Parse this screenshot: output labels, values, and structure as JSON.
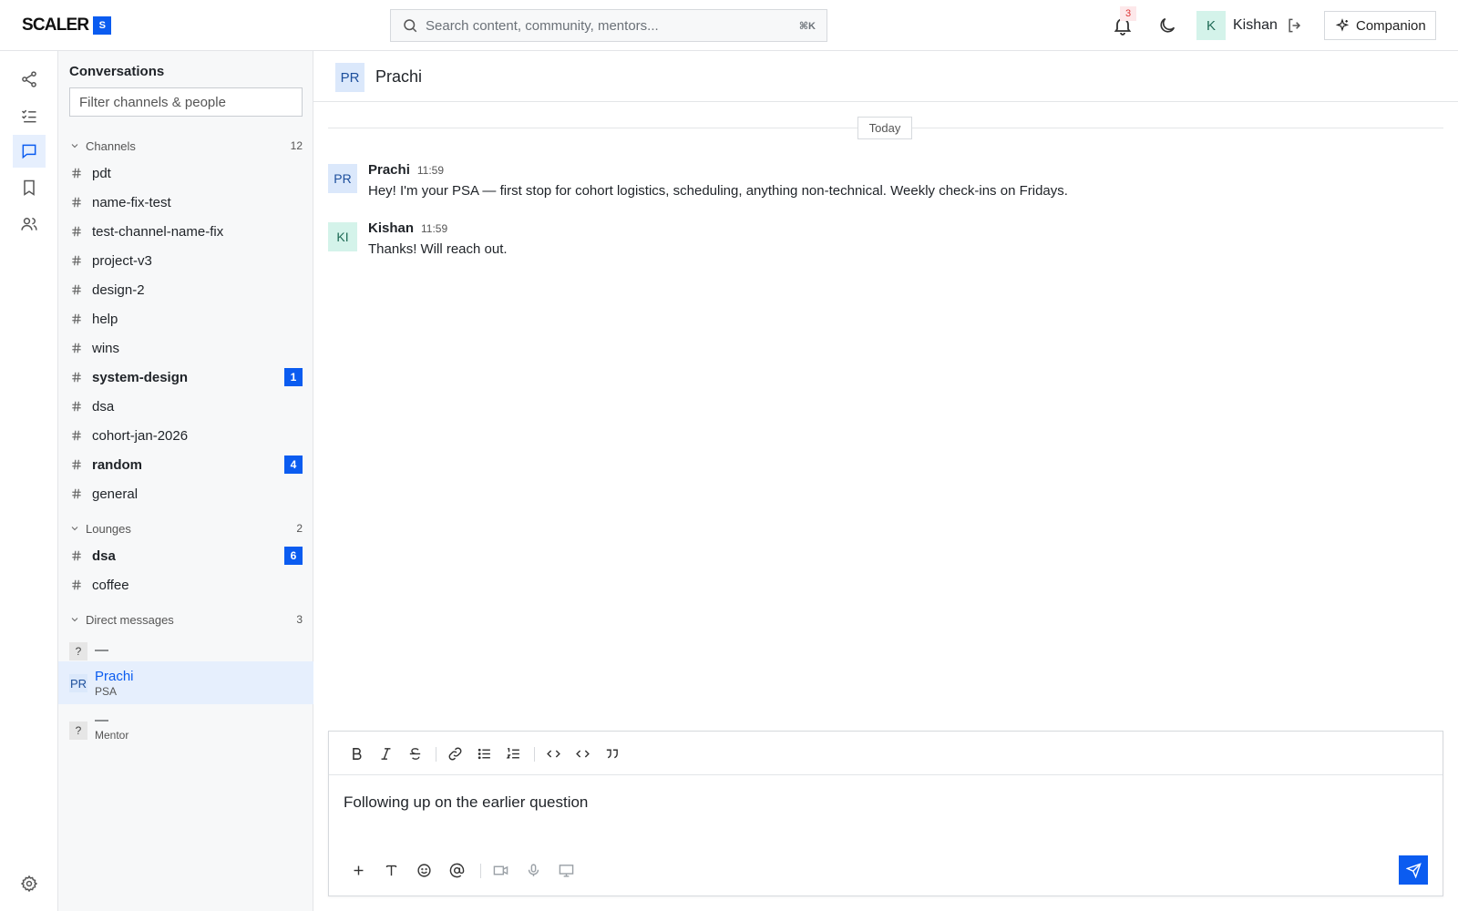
{
  "app": {
    "logo_text": "SCALER",
    "logo_mark": "S",
    "search_placeholder": "Search content, community, mentors...",
    "search_shortcut": "⌘K",
    "notification_count": "3",
    "user_initial": "K",
    "user_name": "Kishan",
    "companion_label": "Companion"
  },
  "rail": {
    "items": [
      {
        "icon": "share-icon",
        "active": false
      },
      {
        "icon": "checklist-icon",
        "active": false
      },
      {
        "icon": "chat-icon",
        "active": true
      },
      {
        "icon": "bookmark-icon",
        "active": false
      },
      {
        "icon": "users-icon",
        "active": false
      }
    ],
    "settings_icon": "gear-icon"
  },
  "sidebar": {
    "title": "Conversations",
    "filter_placeholder": "Filter channels & people",
    "channels_label": "Channels",
    "channels_count": "12",
    "channels": [
      {
        "name": "pdt"
      },
      {
        "name": "name-fix-test"
      },
      {
        "name": "test-channel-name-fix"
      },
      {
        "name": "project-v3"
      },
      {
        "name": "design-2"
      },
      {
        "name": "help"
      },
      {
        "name": "wins"
      },
      {
        "name": "system-design",
        "unread": "1"
      },
      {
        "name": "dsa"
      },
      {
        "name": "cohort-jan-2026"
      },
      {
        "name": "random",
        "unread": "4"
      },
      {
        "name": "general"
      }
    ],
    "lounges_label": "Lounges",
    "lounges_count": "2",
    "lounges": [
      {
        "name": "dsa",
        "unread": "6"
      },
      {
        "name": "coffee"
      }
    ],
    "dms_label": "Direct messages",
    "dms_count": "3",
    "dms": [
      {
        "avatar": "?",
        "name": "—",
        "role": ""
      },
      {
        "avatar": "PR",
        "name": "Prachi",
        "role": "PSA"
      },
      {
        "avatar": "?",
        "name": "—",
        "role": "Mentor"
      }
    ]
  },
  "chat": {
    "avatar": "PR",
    "title": "Prachi",
    "day_label": "Today",
    "messages": [
      {
        "avatar": "PR",
        "author": "Prachi",
        "time": "11:59",
        "text": "Hey! I'm your PSA — first stop for cohort logistics, scheduling, anything non-technical. Weekly check-ins on Fridays."
      },
      {
        "avatar": "KI",
        "author": "Kishan",
        "time": "11:59",
        "text": "Thanks! Will reach out."
      }
    ],
    "composer_text": "Following up on the earlier question",
    "format_tools": [
      "bold-icon",
      "italic-icon",
      "strikethrough-icon",
      "link-icon",
      "bullet-list-icon",
      "numbered-list-icon",
      "code-icon",
      "code-block-icon",
      "quote-icon"
    ],
    "bottom_tools": [
      "plus-icon",
      "text-format-icon",
      "emoji-icon",
      "mention-icon",
      "video-icon",
      "microphone-icon",
      "screen-share-icon"
    ]
  },
  "colors": {
    "accent": "#0b5cf0",
    "active_bg": "#e6effd",
    "sidebar_bg": "#f7f8f9",
    "avatar_blue": "#dbe8fb",
    "avatar_green": "#d4f3ea"
  }
}
